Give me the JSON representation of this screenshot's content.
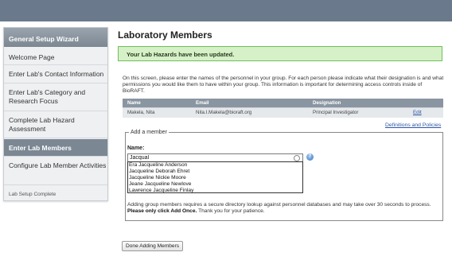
{
  "sidebar": {
    "header": "General Setup Wizard",
    "items": [
      {
        "label": "Welcome Page"
      },
      {
        "label": "Enter Lab's Contact Information"
      },
      {
        "label": "Enter Lab's Category and Research Focus"
      },
      {
        "label": "Complete Lab Hazard Assessment"
      },
      {
        "label": "Enter Lab Members"
      },
      {
        "label": "Configure Lab Member Activities"
      },
      {
        "label": "Lab Setup Complete"
      }
    ]
  },
  "main": {
    "title": "Laboratory Members",
    "notice": "Your Lab Hazards have been updated.",
    "intro": "On this screen, please enter the names of the personnel in your group. For each person please indicate what their designation is and what permissions you would like them to have within your group. This information is important for determining access controls inside of BioRAFT.",
    "table": {
      "headers": [
        "Name",
        "Email",
        "Designation",
        ""
      ],
      "rows": [
        {
          "name": "Makela, Nita",
          "email": "Nita.I.Makela@bioraft.org",
          "designation": "Principal Investigator",
          "action": "Edit"
        }
      ]
    },
    "definitions_link": "Definitions and Policies",
    "add_member": {
      "legend": "Add a member",
      "name_label": "Name:",
      "name_value": "Jacqual",
      "help_icon": "?",
      "suggestions": [
        "Era Jacqueline Anderson",
        "Jacqueline Deborah Ehret",
        "Jacqueline Nickie Moore",
        "Jeane Jacqueline Newlove",
        "Lawrence Jacqueline Finlay"
      ],
      "note_prefix": "Adding group members requires a secure directory lookup against personnel databases and may take over 30 seconds to process.",
      "note_bold": "Please only click Add Once.",
      "note_suffix": "Thank you for your patience."
    },
    "done_button": "Done Adding Members"
  },
  "colors": {
    "topbar": "#6a7a8c",
    "sidebar_active": "#7b8793",
    "notice_bg": "#d6f0c7",
    "notice_border": "#6cc15a",
    "table_header": "#8a95a2",
    "link": "#2c56a6"
  }
}
